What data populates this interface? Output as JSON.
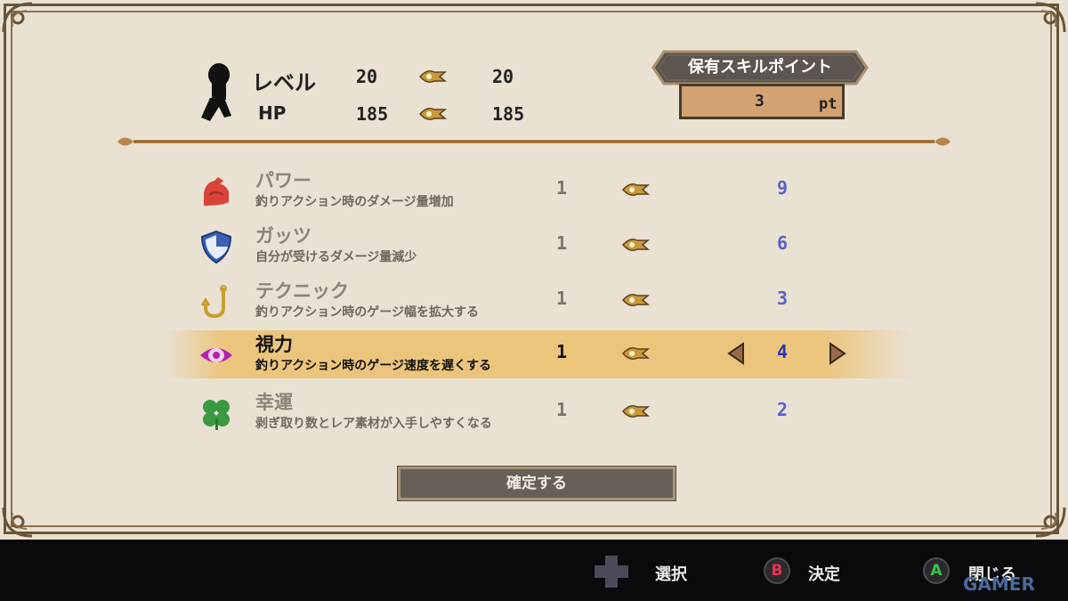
{
  "player": {
    "level_label": "レベル",
    "level_current": "20",
    "level_next": "20",
    "hp_label": "HP",
    "hp_current": "185",
    "hp_next": "185"
  },
  "skill_points": {
    "title": "保有スキルポイント",
    "value": "3",
    "unit": "pt"
  },
  "skills": [
    {
      "name": "パワー",
      "desc": "釣りアクション時のダメージ量増加",
      "current": "1",
      "next": "9",
      "icon": "muscle-icon",
      "icon_color": "#d8433a"
    },
    {
      "name": "ガッツ",
      "desc": "自分が受けるダメージ量減少",
      "current": "1",
      "next": "6",
      "icon": "shield-icon",
      "icon_color": "#3a5fb8"
    },
    {
      "name": "テクニック",
      "desc": "釣りアクション時のゲージ幅を拡大する",
      "current": "1",
      "next": "3",
      "icon": "hook-icon",
      "icon_color": "#c8a030"
    },
    {
      "name": "視力",
      "desc": "釣りアクション時のゲージ速度を遅くする",
      "current": "1",
      "next": "4",
      "icon": "eye-icon",
      "icon_color": "#b020b0",
      "selected": true
    },
    {
      "name": "幸運",
      "desc": "剥ぎ取り数とレア素材が入手しやすくなる",
      "current": "1",
      "next": "2",
      "icon": "clover-icon",
      "icon_color": "#3a9a40"
    }
  ],
  "confirm_label": "確定する",
  "footer": {
    "select_label": "選択",
    "decide_button": "B",
    "decide_label": "決定",
    "close_button": "A",
    "close_label": "閉じる"
  },
  "watermark": "GAMER",
  "colors": {
    "panel_bg": "#e9e1d2",
    "frame": "#6b5538",
    "selected_row": "#ebc57c",
    "next_value": "#5a62c8",
    "confirm_bg": "#666058"
  }
}
